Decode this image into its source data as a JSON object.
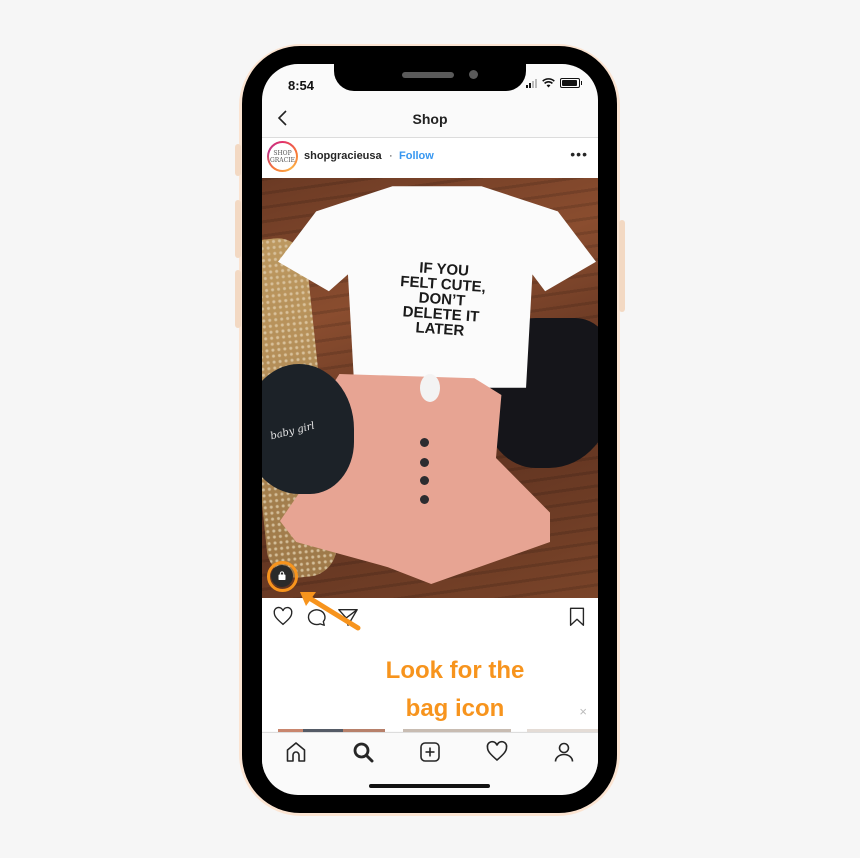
{
  "status_bar": {
    "time": "8:54"
  },
  "nav": {
    "title": "Shop",
    "back_icon": "chevron-left-icon"
  },
  "post": {
    "avatar_text_line1": "SHOP",
    "avatar_text_line2": "GRACIE",
    "username": "shopgracieusa",
    "separator": "·",
    "follow_label": "Follow",
    "more_label": "•••",
    "image": {
      "shirt_text": [
        "IF YOU",
        "FELT CUTE,",
        "DON’T",
        "DELETE IT",
        "LATER"
      ],
      "cap_text": "baby girl"
    }
  },
  "annotation": {
    "line1": "Look for the",
    "line2": "bag icon",
    "color": "#f7941d"
  },
  "dismiss_label": "×",
  "tabbar": {
    "items": [
      "home-icon",
      "search-icon",
      "add-post-icon",
      "activity-heart-icon",
      "profile-icon"
    ],
    "active": "search-icon"
  },
  "colors": {
    "link": "#3897f0",
    "accent": "#f7941d",
    "phone_frame": "#000000",
    "phone_rim": "#fbe4d2"
  }
}
